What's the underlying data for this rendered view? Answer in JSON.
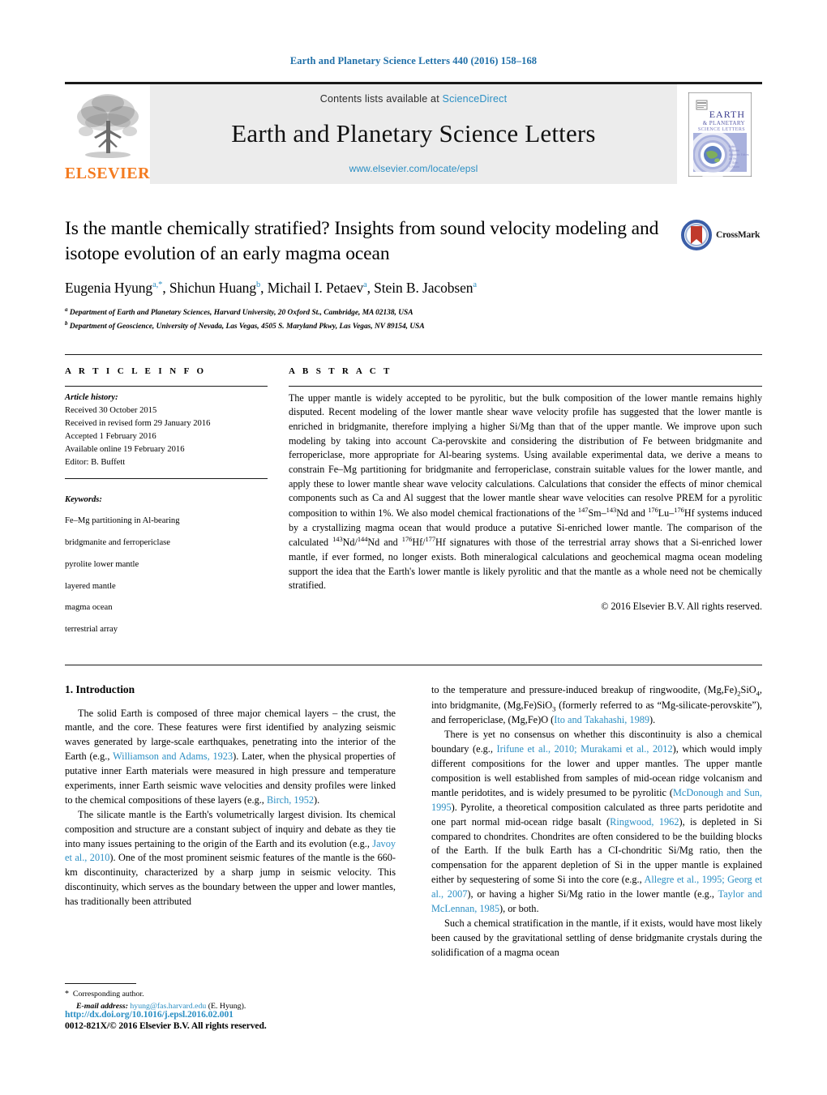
{
  "running_head": "Earth and Planetary Science Letters 440 (2016) 158–168",
  "masthead": {
    "publisher": "ELSEVIER",
    "contents_prefix": "Contents lists available at ",
    "contents_link": "ScienceDirect",
    "journal_name": "Earth and Planetary Science Letters",
    "journal_url": "www.elsevier.com/locate/epsl",
    "cover_title_line1": "EARTH",
    "cover_title_line2": "& PLANETARY",
    "cover_title_line3": "SCIENCE LETTERS"
  },
  "crossmark": {
    "label": "CrossMark"
  },
  "article": {
    "title": "Is the mantle chemically stratified? Insights from sound velocity modeling and isotope evolution of an early magma ocean",
    "authors": [
      {
        "name": "Eugenia Hyung",
        "marks": "a,*"
      },
      {
        "name": "Shichun Huang",
        "marks": "b"
      },
      {
        "name": "Michail I. Petaev",
        "marks": "a"
      },
      {
        "name": "Stein B. Jacobsen",
        "marks": "a"
      }
    ],
    "affiliations": [
      {
        "mark": "a",
        "text": "Department of Earth and Planetary Sciences, Harvard University, 20 Oxford St., Cambridge, MA 02138, USA"
      },
      {
        "mark": "b",
        "text": "Department of Geoscience, University of Nevada, Las Vegas, 4505 S. Maryland Pkwy, Las Vegas, NV 89154, USA"
      }
    ]
  },
  "article_info": {
    "heading": "A R T I C L E   I N F O",
    "history_label": "Article history:",
    "history": [
      "Received 30 October 2015",
      "Received in revised form 29 January 2016",
      "Accepted 1 February 2016",
      "Available online 19 February 2016",
      "Editor: B. Buffett"
    ],
    "keywords_label": "Keywords:",
    "keywords": [
      "Fe–Mg partitioning in Al-bearing",
      "bridgmanite and ferropericlase",
      "pyrolite lower mantle",
      "layered mantle",
      "magma ocean",
      "terrestrial array"
    ]
  },
  "abstract": {
    "heading": "A B S T R A C T",
    "part1": "The upper mantle is widely accepted to be pyrolitic, but the bulk composition of the lower mantle remains highly disputed. Recent modeling of the lower mantle shear wave velocity profile has suggested that the lower mantle is enriched in bridgmanite, therefore implying a higher Si/Mg than that of the upper mantle. We improve upon such modeling by taking into account Ca-perovskite and considering the distribution of Fe between bridgmanite and ferropericlase, more appropriate for Al-bearing systems. Using available experimental data, we derive a means to constrain Fe–Mg partitioning for bridgmanite and ferropericlase, constrain suitable values for the lower mantle, and apply these to lower mantle shear wave velocity calculations. Calculations that consider the effects of minor chemical components such as Ca and Al suggest that the lower mantle shear wave velocities can resolve PREM for a pyrolitic composition to within 1%. We also model chemical fractionations of the ",
    "sup1": "147",
    "iso1": "Sm–",
    "sup2": "143",
    "iso2": "Nd and ",
    "sup3": "176",
    "iso3": "Lu–",
    "sup4": "176",
    "iso4": "Hf systems ",
    "part2": "induced by a crystallizing magma ocean that would produce a putative Si-enriched lower mantle. The comparison of the calculated ",
    "sup5": "143",
    "iso5": "Nd/",
    "sup6": "144",
    "iso6": "Nd and ",
    "sup7": "176",
    "iso7": "Hf/",
    "sup8": "177",
    "iso8": "Hf ",
    "part3": "signatures with those of the terrestrial array shows that a Si-enriched lower mantle, if ever formed, no longer exists. Both mineralogical calculations and geochemical magma ocean modeling support the idea that the Earth's lower mantle is likely pyrolitic and that the mantle as a whole need not be chemically stratified.",
    "copyright": "© 2016 Elsevier B.V. All rights reserved."
  },
  "body": {
    "section_number_title": "1. Introduction",
    "left": {
      "p1_a": "The solid Earth is composed of three major chemical layers – the crust, the mantle, and the core. These features were first identified by analyzing seismic waves generated by large-scale earthquakes, penetrating into the interior of the Earth (e.g., ",
      "p1_ref1": "Williamson and Adams, 1923",
      "p1_b": "). Later, when the physical properties of putative inner Earth materials were measured in high pressure and temperature experiments, inner Earth seismic wave velocities and density profiles were linked to the chemical compositions of these layers (e.g., ",
      "p1_ref2": "Birch, 1952",
      "p1_c": ").",
      "p2_a": "The silicate mantle is the Earth's volumetrically largest division. Its chemical composition and structure are a constant subject of inquiry and debate as they tie into many issues pertaining to the origin of the Earth and its evolution (e.g., ",
      "p2_ref1": "Javoy et al., 2010",
      "p2_b": "). One of the most prominent seismic features of the mantle is the 660-km discontinuity, characterized by a sharp jump in seismic velocity. This discontinuity, which serves as the boundary between the upper and lower mantles, has traditionally been attributed"
    },
    "right": {
      "p1_a": "to the temperature and pressure-induced breakup of ringwoodite, (Mg,Fe)",
      "p1_sub1": "2",
      "p1_b": "SiO",
      "p1_sub2": "4",
      "p1_c": ", into bridgmanite, (Mg,Fe)SiO",
      "p1_sub3": "3",
      "p1_d": " (formerly referred to as “Mg-silicate-perovskite”), and ferropericlase, (Mg,Fe)O (",
      "p1_ref1": "Ito and Takahashi, 1989",
      "p1_e": ").",
      "p2_a": "There is yet no consensus on whether this discontinuity is also a chemical boundary (e.g., ",
      "p2_ref1": "Irifune et al., 2010; Murakami et al., 2012",
      "p2_b": "), which would imply different compositions for the lower and upper mantles. The upper mantle composition is well established from samples of mid-ocean ridge volcanism and mantle peridotites, and is widely presumed to be pyrolitic (",
      "p2_ref2": "McDonough and Sun, 1995",
      "p2_c": "). Pyrolite, a theoretical composition calculated as three parts peridotite and one part normal mid-ocean ridge basalt (",
      "p2_ref3": "Ringwood, 1962",
      "p2_d": "), is depleted in Si compared to chondrites. Chondrites are often considered to be the building blocks of the Earth. If the bulk Earth has a CI-chondritic Si/Mg ratio, then the compensation for the apparent depletion of Si in the upper mantle is explained either by sequestering of some Si into the core (e.g., ",
      "p2_ref4": "Allegre et al., 1995; Georg et al., 2007",
      "p2_e": "), or having a higher Si/Mg ratio in the lower mantle (e.g., ",
      "p2_ref5": "Taylor and McLennan, 1985",
      "p2_f": "), or both.",
      "p3": "Such a chemical stratification in the mantle, if it exists, would have most likely been caused by the gravitational settling of dense bridgmanite crystals during the solidification of a magma ocean"
    }
  },
  "footnote": {
    "star": "*",
    "corresponding": "Corresponding author.",
    "email_label": "E-mail address:",
    "email": "hyung@fas.harvard.edu",
    "email_suffix": "(E. Hyung)."
  },
  "footer": {
    "doi": "http://dx.doi.org/10.1016/j.epsl.2016.02.001",
    "issn_line": "0012-821X/© 2016 Elsevier B.V. All rights reserved."
  },
  "colors": {
    "link_blue": "#2b8fc4",
    "runhead_blue": "#1f6fa8",
    "elsevier_orange": "#f47b20",
    "masthead_grey": "#ececec"
  }
}
